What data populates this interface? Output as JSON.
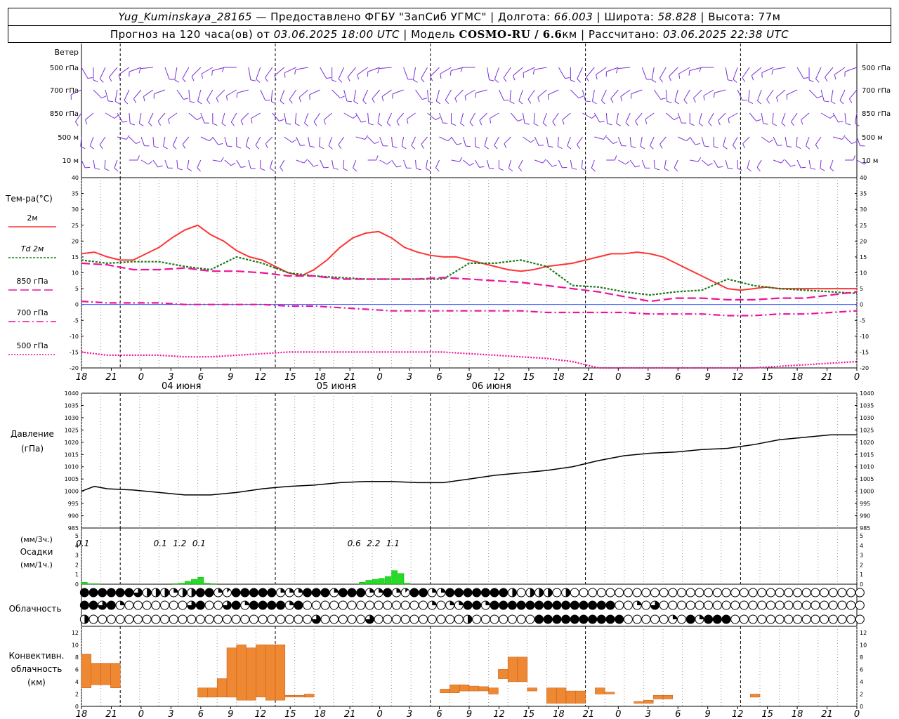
{
  "header": {
    "station": "Yug_Kuminskaya_28165",
    "provider_prefix": " — Предоставлено ФГБУ \"ЗапСиб УГМС\" | Долгота: ",
    "lon": "66.003",
    "lat_label": " | Широта: ",
    "lat": "58.828",
    "alt_label": " | Высота: 77м",
    "forecast_prefix": "Прогноз на 120 часа(ов) от ",
    "forecast_start": "03.06.2025 18:00 UTC",
    "model_prefix": "  | Модель ",
    "model_name": "COSMO-RU / 6.6",
    "model_suffix": "км | Рассчитано: ",
    "computed": "03.06.2025 22:38 UTC"
  },
  "hour_labels": [
    "18",
    "21",
    "0",
    "3",
    "6",
    "9",
    "12",
    "15",
    "18",
    "21",
    "0",
    "3",
    "6",
    "9",
    "12",
    "15",
    "18",
    "21",
    "0",
    "3",
    "6",
    "9",
    "12",
    "15",
    "18",
    "21",
    "0"
  ],
  "day_labels": [
    {
      "label": "04 июня",
      "hour": 6
    },
    {
      "label": "05 июня",
      "hour": 30
    },
    {
      "label": "06 июня",
      "hour": 54
    }
  ],
  "wind_panel": {
    "title": "Ветер",
    "levels": [
      "500 гПа",
      "700 гПа",
      "850 гПа",
      "500 м",
      "10 м"
    ],
    "color": "#7b2fd9"
  },
  "temp_panel": {
    "title": "Тем-ра(°C)",
    "ylim": [
      -20,
      40
    ],
    "ticks": [
      40,
      35,
      30,
      25,
      20,
      15,
      10,
      5,
      0,
      -5,
      -10,
      -15,
      -20
    ],
    "legend": [
      {
        "label": "2м",
        "color": "#ff3333",
        "dash": ""
      },
      {
        "label": "Td  2м",
        "color": "#1a7a1a",
        "dash": "3,2"
      },
      {
        "label": "850 гПа",
        "color": "#ee1199",
        "dash": "12,5"
      },
      {
        "label": "700 гПа",
        "color": "#ee1199",
        "dash": "10,4,2,4"
      },
      {
        "label": "500 гПа",
        "color": "#ee1199",
        "dash": "2,2"
      }
    ]
  },
  "pressure_panel": {
    "title": "Давление",
    "unit": "(гПа)",
    "ylim": [
      985,
      1040
    ],
    "ticks": [
      1040,
      1035,
      1030,
      1025,
      1020,
      1015,
      1010,
      1005,
      1000,
      995,
      990,
      985
    ]
  },
  "precip_panel": {
    "unit3h": "(мм/3ч.)",
    "title": "Осадки",
    "unit1h": "(мм/1ч.)",
    "ticks": [
      5,
      4,
      3,
      2,
      1,
      0
    ],
    "ylim": [
      0,
      5
    ],
    "color": "#22dd22",
    "annotations": [
      {
        "hour": 1.5,
        "text": "0.1"
      },
      {
        "hour": 13.5,
        "text": "0.1"
      },
      {
        "hour": 16.5,
        "text": "1.2"
      },
      {
        "hour": 19.5,
        "text": "0.1"
      },
      {
        "hour": 43.5,
        "text": "0.6"
      },
      {
        "hour": 46.5,
        "text": "2.2"
      },
      {
        "hour": 49.5,
        "text": "1.1"
      }
    ]
  },
  "cloud_panel": {
    "title": "Облачность",
    "rows": [
      "8888886444244882188888222888288822821882288888884044404000000000000000000000000000000000",
      "8868200000006800682888828000000000000002022882888888888888880020600000000000000000000000",
      "4000000000000000000000000060000060000000000400000008888888888000002082888000000000000000"
    ]
  },
  "conv_panel": {
    "title_lines": [
      "Конвективн.",
      "облачность",
      "(км)"
    ],
    "ylim": [
      0,
      13
    ],
    "ticks": [
      12,
      10,
      8,
      6,
      4,
      2,
      0
    ],
    "color": "#ee8833"
  },
  "chart_data": [
    {
      "type": "line",
      "title": "Тем-ра(°C)",
      "x_unit": "hours from 03.06.2025 18:00 UTC",
      "ylim": [
        -20,
        40
      ],
      "series": [
        {
          "name": "2м",
          "x": [
            0,
            2,
            4,
            6,
            8,
            10,
            12,
            14,
            16,
            18,
            20,
            22,
            24,
            26,
            28,
            30,
            32,
            34,
            36,
            38,
            40,
            42,
            44,
            46,
            48,
            50,
            52,
            54,
            56,
            58,
            60,
            62,
            64,
            66,
            68,
            70,
            72,
            74,
            76,
            78,
            80,
            82,
            84,
            86,
            88,
            90,
            92,
            94,
            96,
            98,
            100,
            102,
            104,
            106,
            108,
            110,
            112,
            114,
            116,
            118,
            120
          ],
          "y": [
            16,
            16.5,
            15,
            14,
            14,
            16,
            18,
            21,
            23.5,
            25,
            22,
            20,
            17,
            15,
            14,
            12,
            10,
            9,
            11,
            14,
            18,
            21,
            22.5,
            23,
            21,
            18,
            16.5,
            15.5,
            15,
            15,
            14,
            13,
            12,
            11,
            10.5,
            11,
            12,
            12.5,
            13,
            14,
            15,
            16,
            16,
            16.5,
            16,
            15,
            13,
            11,
            9,
            7,
            5,
            4.5,
            5,
            5.5,
            5,
            5,
            5,
            5,
            5,
            5,
            5
          ]
        },
        {
          "name": "Td  2м",
          "x": [
            0,
            4,
            8,
            12,
            16,
            20,
            24,
            28,
            32,
            36,
            40,
            44,
            48,
            52,
            56,
            60,
            64,
            68,
            72,
            76,
            80,
            84,
            88,
            92,
            96,
            100,
            104,
            108,
            112,
            116,
            120
          ],
          "y": [
            14,
            13,
            13.5,
            13.5,
            12,
            11,
            15,
            13,
            10,
            9,
            8.5,
            8,
            8,
            8,
            8,
            13,
            13,
            14,
            12,
            6,
            5.5,
            4,
            3,
            4,
            4.5,
            8,
            6,
            5,
            4.5,
            4,
            3.5
          ]
        },
        {
          "name": "850 гПа",
          "x": [
            0,
            4,
            8,
            12,
            16,
            20,
            24,
            28,
            32,
            36,
            40,
            44,
            48,
            52,
            56,
            60,
            64,
            68,
            72,
            76,
            80,
            84,
            88,
            92,
            96,
            100,
            104,
            108,
            112,
            116,
            120
          ],
          "y": [
            13,
            12.5,
            11,
            11,
            11.5,
            10.5,
            10.5,
            10,
            9,
            9,
            8,
            8,
            8,
            8,
            8.5,
            8,
            7.5,
            7,
            6,
            5,
            4,
            2.5,
            1,
            2,
            2,
            1.5,
            1.5,
            2,
            2,
            3,
            4
          ]
        },
        {
          "name": "700 гПа",
          "x": [
            0,
            4,
            8,
            12,
            16,
            20,
            24,
            28,
            32,
            36,
            40,
            44,
            48,
            52,
            56,
            60,
            64,
            68,
            72,
            76,
            80,
            84,
            88,
            92,
            96,
            100,
            104,
            108,
            112,
            116,
            120
          ],
          "y": [
            1,
            0.5,
            0.5,
            0.5,
            0,
            0,
            0,
            0,
            -0.5,
            -0.5,
            -1,
            -1.5,
            -2,
            -2,
            -2,
            -2,
            -2,
            -2,
            -2.5,
            -2.5,
            -2.5,
            -2.5,
            -3,
            -3,
            -3,
            -3.5,
            -3.5,
            -3,
            -3,
            -2.5,
            -2
          ]
        },
        {
          "name": "500 гПа",
          "x": [
            0,
            4,
            8,
            12,
            16,
            20,
            24,
            28,
            32,
            36,
            40,
            44,
            48,
            52,
            56,
            60,
            64,
            68,
            72,
            76,
            80,
            84,
            88,
            92,
            96,
            100,
            104,
            108,
            112,
            116,
            120
          ],
          "y": [
            -15,
            -16,
            -16,
            -16,
            -16.5,
            -16.5,
            -16,
            -15.5,
            -15,
            -15,
            -15,
            -15,
            -15,
            -15,
            -15,
            -15.5,
            -16,
            -16.5,
            -17,
            -18,
            -20,
            -21,
            -21,
            -21,
            -20,
            -20,
            -20,
            -19.5,
            -19,
            -18.5,
            -18
          ]
        }
      ]
    },
    {
      "type": "line",
      "title": "Давление",
      "ylabel": "(гПа)",
      "ylim": [
        985,
        1040
      ],
      "series": [
        {
          "name": "Давление",
          "x": [
            0,
            2,
            4,
            8,
            12,
            16,
            20,
            24,
            28,
            32,
            36,
            40,
            44,
            48,
            52,
            56,
            60,
            64,
            68,
            72,
            76,
            80,
            84,
            88,
            92,
            96,
            100,
            104,
            108,
            112,
            116,
            120
          ],
          "y": [
            1000,
            1002,
            1001,
            1000.5,
            999.5,
            998.5,
            998.5,
            999.5,
            1001,
            1002,
            1002.5,
            1003.5,
            1004,
            1004,
            1003.5,
            1003.5,
            1005,
            1006.5,
            1007.5,
            1008.5,
            1010,
            1012.5,
            1014.5,
            1015.5,
            1016,
            1017,
            1017.5,
            1019,
            1021,
            1022,
            1023,
            1023
          ]
        }
      ]
    },
    {
      "type": "bar",
      "title": "Осадки",
      "ylabel": "(мм/1ч.)",
      "ylim": [
        0,
        5
      ],
      "x": [
        0,
        1,
        2,
        14,
        15,
        16,
        17,
        18,
        19,
        20,
        43,
        44,
        45,
        46,
        47,
        48,
        49,
        50
      ],
      "values": [
        0.2,
        0.05,
        0.05,
        0.05,
        0.1,
        0.3,
        0.5,
        0.7,
        0.1,
        0.05,
        0.2,
        0.4,
        0.5,
        0.6,
        0.8,
        1.4,
        1.1,
        0.1
      ]
    },
    {
      "type": "bar",
      "title": "Конвективн. облачность",
      "ylabel": "(км)",
      "ylim": [
        0,
        13
      ],
      "bars": [
        {
          "x": 0,
          "bottom": 3,
          "top": 8.5
        },
        {
          "x": 1,
          "bottom": 3.5,
          "top": 7
        },
        {
          "x": 2,
          "bottom": 3.5,
          "top": 7
        },
        {
          "x": 3,
          "bottom": 3,
          "top": 7
        },
        {
          "x": 12,
          "bottom": 1.5,
          "top": 3
        },
        {
          "x": 13,
          "bottom": 1.5,
          "top": 3
        },
        {
          "x": 14,
          "bottom": 1.5,
          "top": 4.5
        },
        {
          "x": 15,
          "bottom": 1.5,
          "top": 9.5
        },
        {
          "x": 16,
          "bottom": 1,
          "top": 10
        },
        {
          "x": 17,
          "bottom": 1,
          "top": 9.5
        },
        {
          "x": 18,
          "bottom": 1.5,
          "top": 10
        },
        {
          "x": 19,
          "bottom": 1,
          "top": 10
        },
        {
          "x": 20,
          "bottom": 1,
          "top": 10
        },
        {
          "x": 21,
          "bottom": 1.5,
          "top": 1.8
        },
        {
          "x": 22,
          "bottom": 1.5,
          "top": 1.8
        },
        {
          "x": 23,
          "bottom": 1.5,
          "top": 2
        },
        {
          "x": 37,
          "bottom": 2.2,
          "top": 2.8
        },
        {
          "x": 38,
          "bottom": 2.2,
          "top": 3.5
        },
        {
          "x": 39,
          "bottom": 2.5,
          "top": 3.5
        },
        {
          "x": 40,
          "bottom": 2.5,
          "top": 3.3
        },
        {
          "x": 41,
          "bottom": 2.5,
          "top": 3.2
        },
        {
          "x": 42,
          "bottom": 2,
          "top": 3
        },
        {
          "x": 43,
          "bottom": 4.5,
          "top": 6
        },
        {
          "x": 44,
          "bottom": 4,
          "top": 8
        },
        {
          "x": 45,
          "bottom": 4,
          "top": 8
        },
        {
          "x": 46,
          "bottom": 2.5,
          "top": 3
        },
        {
          "x": 48,
          "bottom": 0.5,
          "top": 3
        },
        {
          "x": 49,
          "bottom": 0.5,
          "top": 3
        },
        {
          "x": 50,
          "bottom": 0.5,
          "top": 2.5
        },
        {
          "x": 51,
          "bottom": 0.5,
          "top": 2.5
        },
        {
          "x": 53,
          "bottom": 2,
          "top": 3
        },
        {
          "x": 54,
          "bottom": 2,
          "top": 2.3
        },
        {
          "x": 57,
          "bottom": 0.5,
          "top": 0.8
        },
        {
          "x": 58,
          "bottom": 0.5,
          "top": 1
        },
        {
          "x": 59,
          "bottom": 1.2,
          "top": 1.8
        },
        {
          "x": 60,
          "bottom": 1.2,
          "top": 1.8
        },
        {
          "x": 69,
          "bottom": 1.5,
          "top": 2
        }
      ]
    }
  ]
}
